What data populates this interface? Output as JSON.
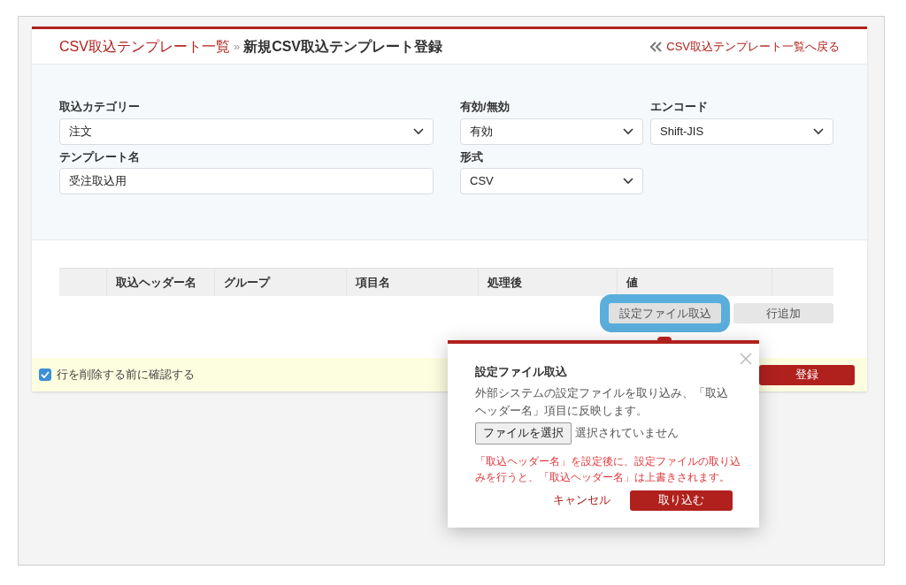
{
  "breadcrumb": {
    "parent": "CSV取込テンプレート一覧",
    "separator": "»",
    "current": "新規CSV取込テンプレート登録"
  },
  "back_link": "CSV取込テンプレート一覧へ戻る",
  "form_rows": [
    [
      {
        "kind": "select",
        "label": "取込カテゴリー",
        "value": "注文"
      },
      {
        "kind": "select",
        "label": "有効/無効",
        "value": "有効"
      },
      {
        "kind": "select",
        "label": "エンコード",
        "value": "Shift-JIS"
      }
    ],
    [
      {
        "kind": "text",
        "label": "テンプレート名",
        "value": "受注取込用"
      },
      {
        "kind": "select",
        "label": "形式",
        "value": "CSV"
      }
    ]
  ],
  "table": {
    "columns": [
      "",
      "取込ヘッダー名",
      "グループ",
      "項目名",
      "処理後",
      "値",
      ""
    ]
  },
  "table_buttons": [
    {
      "label": "設定ファイル取込",
      "highlighted": true
    },
    {
      "label": "行追加",
      "highlighted": false
    }
  ],
  "confirm_checkbox": {
    "label": "行を削除する前に確認する",
    "checked": true
  },
  "register_button": "登録",
  "popover": {
    "title": "設定ファイル取込",
    "description": "外部システムの設定ファイルを取り込み、「取込ヘッダー名」項目に反映します。",
    "file_button": "ファイルを選択",
    "file_status": "選択されていません",
    "warning": "「取込ヘッダー名」を設定後に、設定ファイルの取り込みを行うと、「取込ヘッダー名」は上書きされます。",
    "cancel": "キャンセル",
    "submit": "取り込む"
  }
}
